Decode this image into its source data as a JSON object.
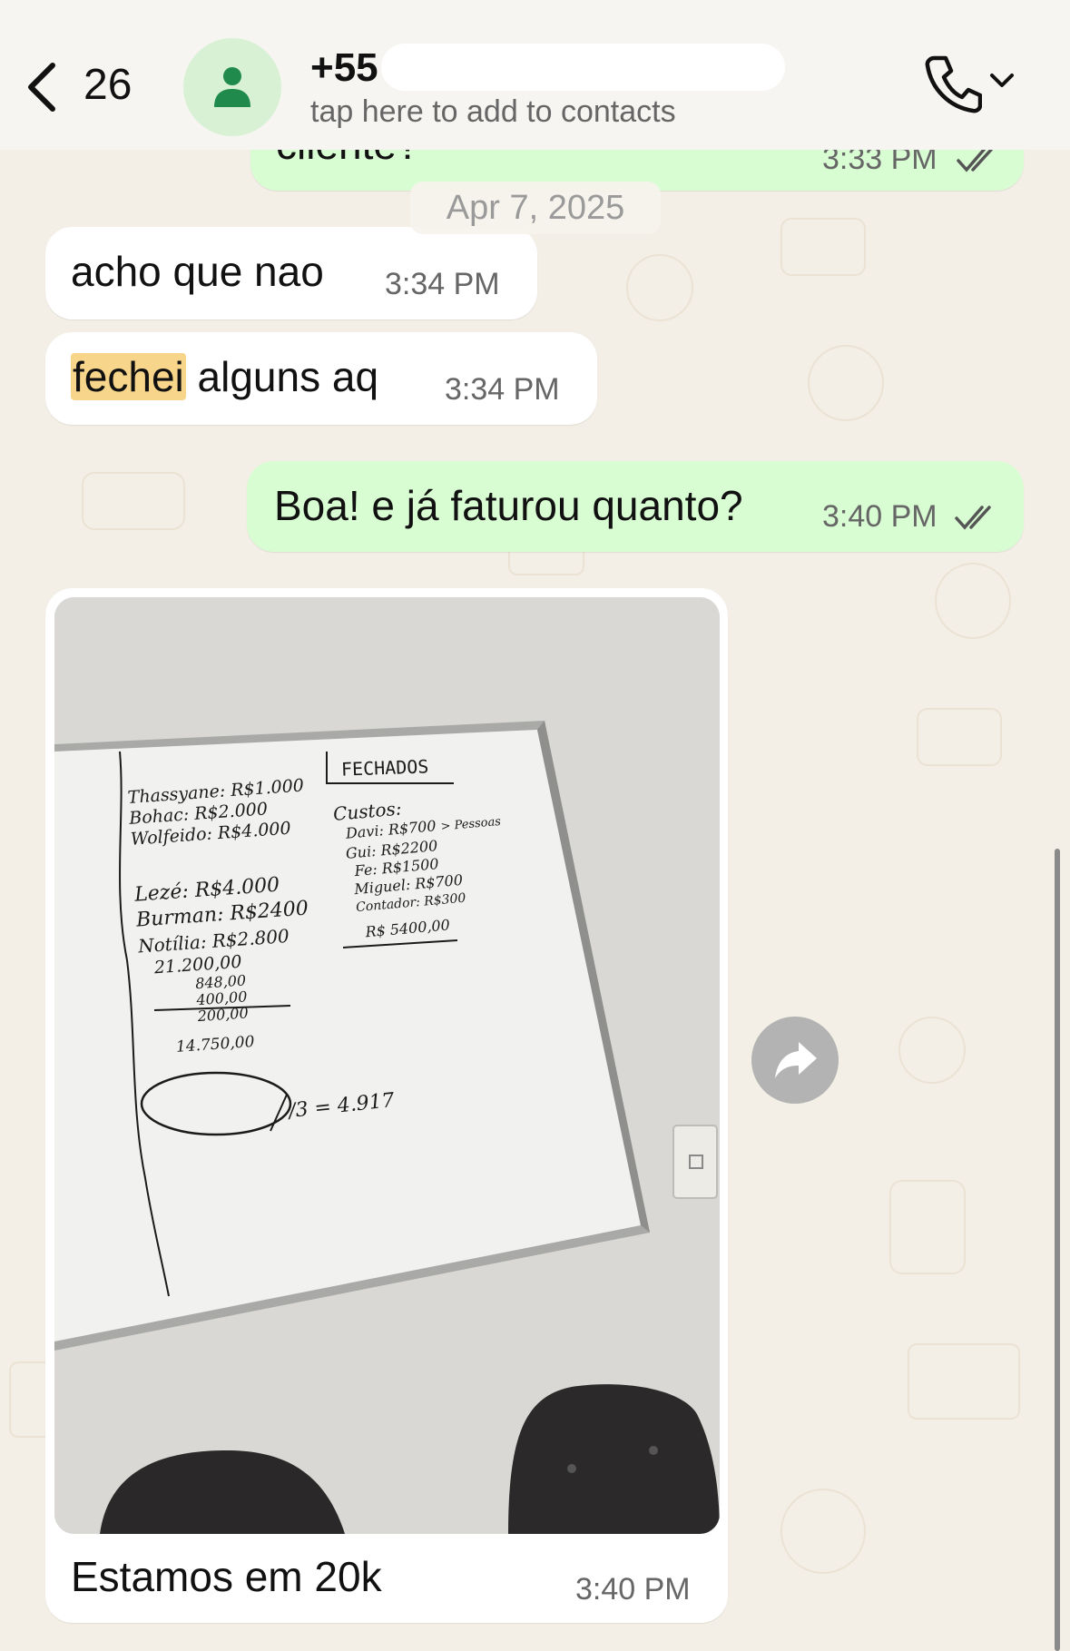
{
  "header": {
    "back_count": "26",
    "contact_name": "+55",
    "subtitle": "tap here to add to contacts",
    "icons": [
      "chevron-left-icon",
      "person-icon",
      "phone-icon",
      "chevron-down-icon"
    ]
  },
  "date_chip": "Apr 7, 2025",
  "messages": [
    {
      "direction": "out",
      "text": "cliente?",
      "time": "3:33 PM",
      "status": "read"
    },
    {
      "direction": "in",
      "text": "acho que nao",
      "time": "3:34 PM"
    },
    {
      "direction": "in",
      "text_highlight": "fechei",
      "text_rest": " alguns aq",
      "time": "3:34 PM"
    },
    {
      "direction": "out",
      "text": "Boa! e já faturou quanto?",
      "time": "3:40 PM",
      "status": "read"
    },
    {
      "direction": "in",
      "type": "image",
      "caption": "Estamos em 20k",
      "time": "3:40 PM"
    }
  ],
  "whiteboard": {
    "heading": "FECHADOS",
    "left_column": [
      "Thassyane: R$1.000",
      "Bohac: R$2.000",
      "Wolfeido: R$4.000",
      "Lezé: R$4.000",
      "Burman: R$2400",
      "Notília: R$2.800",
      "21.200,00",
      "848,00",
      "400,00",
      "200,00",
      "14.750,00"
    ],
    "right_title": "Custos:",
    "right_column": [
      "Davi: R$700",
      "Gui: R$2200",
      "Fe: R$1500",
      "Miguel: R$700",
      "Contador: R$300",
      "R$ 5400,00"
    ],
    "pessoas_note": "> Pessoas",
    "division": "/3 = 4.917"
  },
  "colors": {
    "incoming_bubble": "#ffffff",
    "outgoing_bubble": "#d9fdd3",
    "wallpaper": "#f3efe7",
    "read_ticks": "#555555",
    "avatar_bg": "#d8f1d4",
    "avatar_fg": "#1f8a4c"
  }
}
